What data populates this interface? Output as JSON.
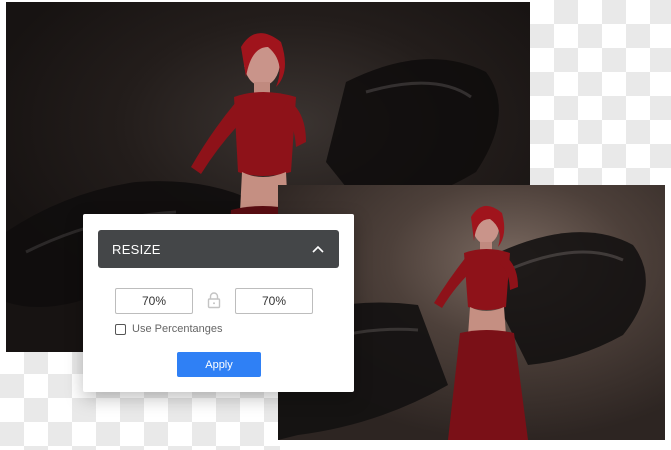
{
  "resize_panel": {
    "title": "RESIZE",
    "width_value": "70%",
    "height_value": "70%",
    "use_percentages_label": "Use Percentanges",
    "use_percentages_checked": false,
    "apply_label": "Apply"
  },
  "colors": {
    "accent": "#2f80f5",
    "header_bg": "#444648"
  },
  "icons": {
    "collapse": "chevron-up-icon",
    "aspect_lock": "lock-icon"
  }
}
